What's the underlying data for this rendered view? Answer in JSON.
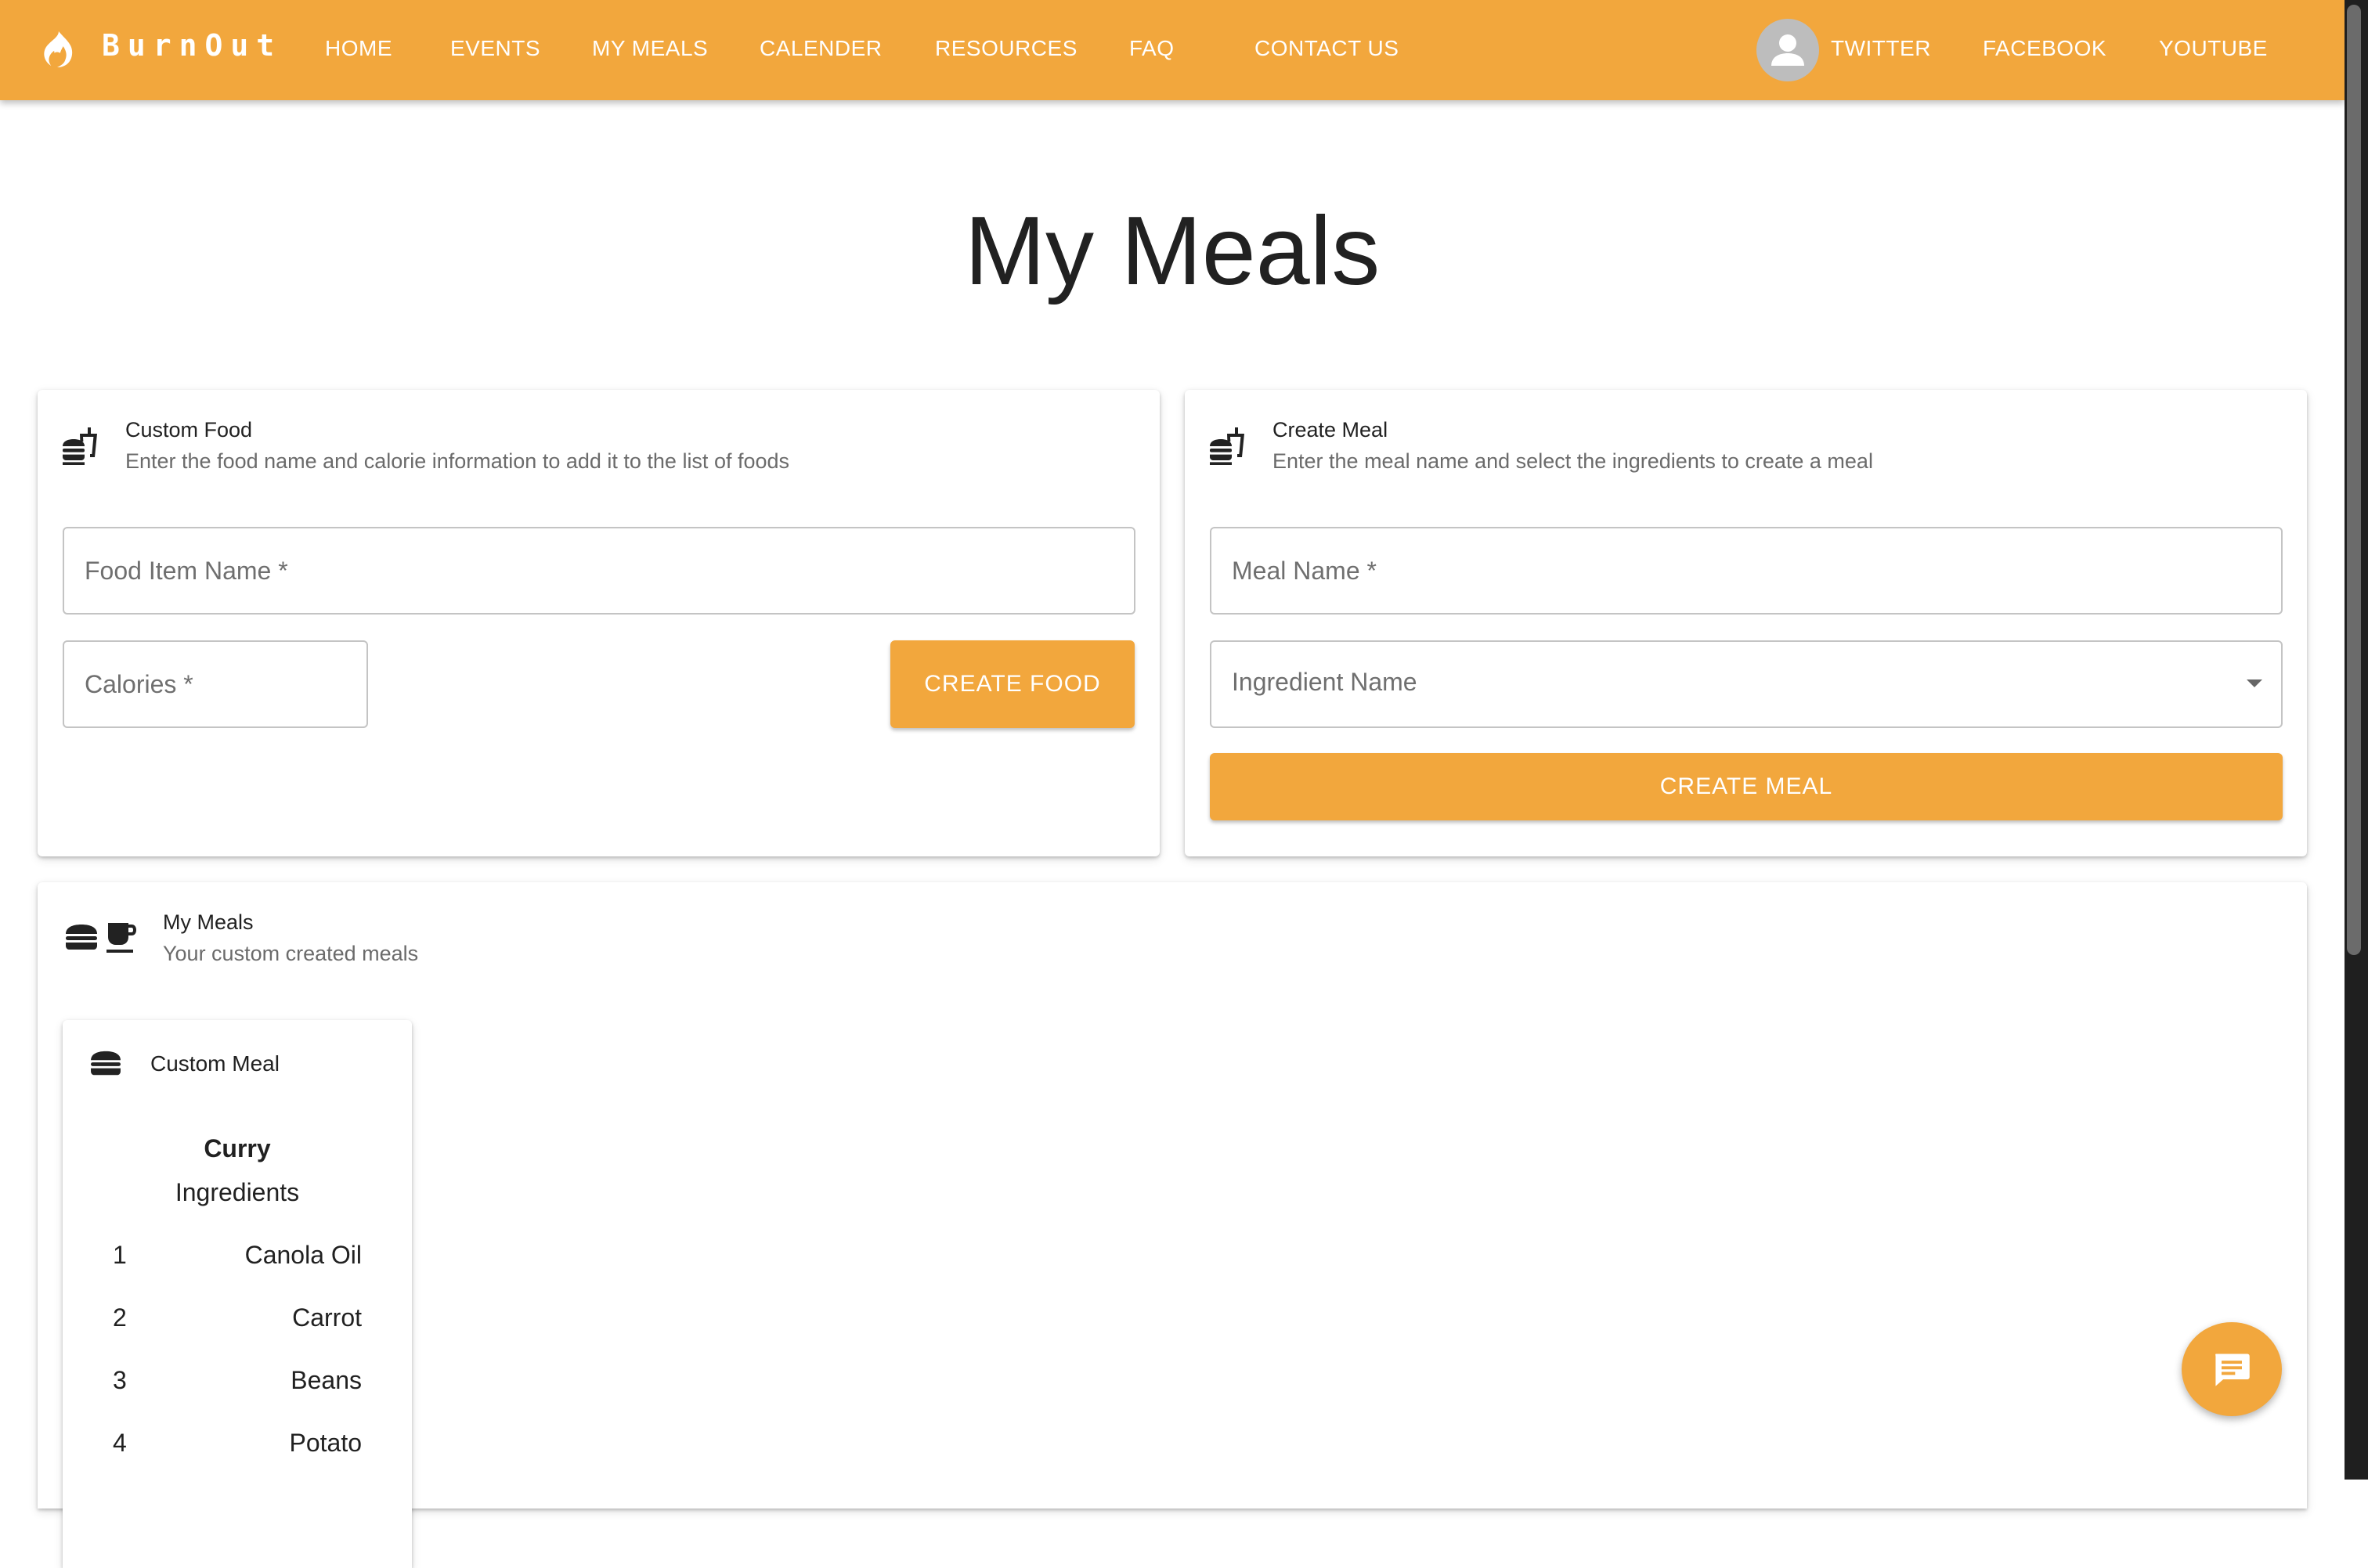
{
  "app": {
    "brand": "BurnOut",
    "nav": [
      "HOME",
      "EVENTS",
      "MY MEALS",
      "CALENDER",
      "RESOURCES",
      "FAQ",
      "CONTACT US"
    ],
    "social": [
      "TWITTER",
      "FACEBOOK",
      "YOUTUBE"
    ],
    "accent_color": "#f2a73d"
  },
  "page": {
    "title": "My Meals"
  },
  "custom_food": {
    "title": "Custom Food",
    "subtitle": "Enter the food name and calorie information to add it to the list of foods",
    "food_name_placeholder": "Food Item Name *",
    "calories_placeholder": "Calories *",
    "button": "CREATE FOOD",
    "icon": "fastfood-icon"
  },
  "create_meal": {
    "title": "Create Meal",
    "subtitle": "Enter the meal name and select the ingredients to create a meal",
    "meal_name_placeholder": "Meal Name *",
    "ingredient_placeholder": "Ingredient Name",
    "button": "CREATE MEAL",
    "icon": "fastfood-icon"
  },
  "my_meals": {
    "title": "My Meals",
    "subtitle": "Your custom created meals",
    "meals": [
      {
        "label": "Custom Meal",
        "name": "Curry",
        "ingredients_heading": "Ingredients",
        "ingredients": [
          {
            "num": "1",
            "name": "Canola Oil"
          },
          {
            "num": "2",
            "name": "Carrot"
          },
          {
            "num": "3",
            "name": "Beans"
          },
          {
            "num": "4",
            "name": "Potato"
          }
        ]
      }
    ]
  }
}
